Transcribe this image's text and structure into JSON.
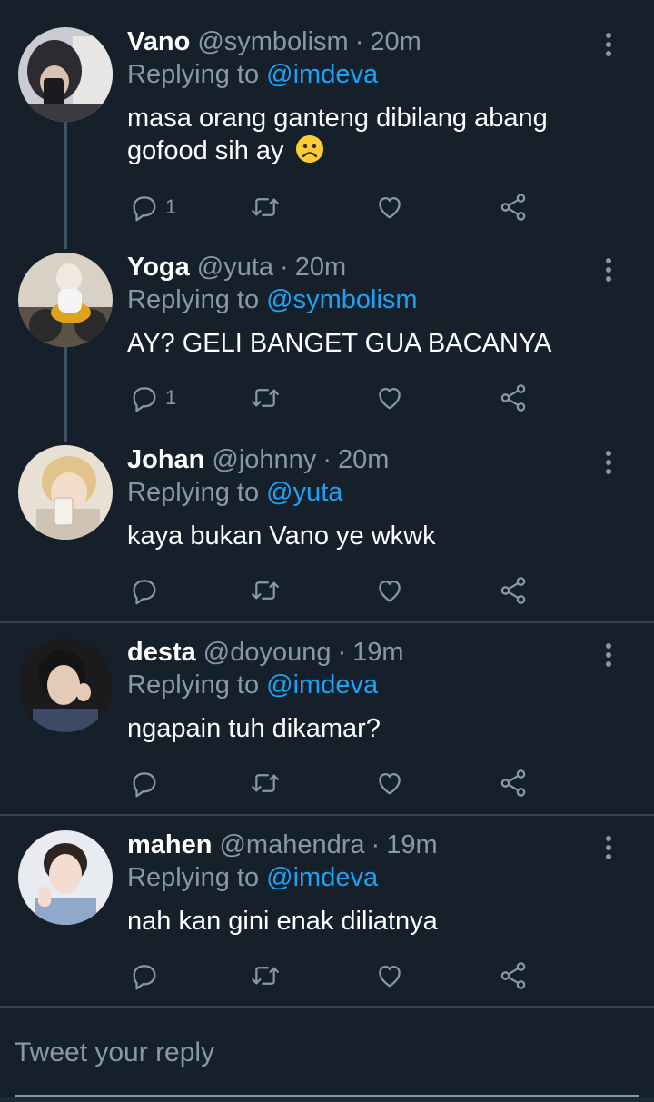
{
  "colors": {
    "background": "#15202b",
    "text": "#ffffff",
    "muted": "#8899a6",
    "link": "#1da1f2",
    "divider": "#38444d",
    "thread_line": "#3d5466"
  },
  "replying_prefix": "Replying to",
  "tweets": [
    {
      "name": "Vano",
      "handle": "@symbolism",
      "time": "20m",
      "replying_to": "@imdeva",
      "text": "masa orang ganteng dibilang abang gofood sih ay",
      "emoji": "frowning-face",
      "reply_count": "1",
      "avatar": "avatar-hooded-person-with-phone"
    },
    {
      "name": "Yoga",
      "handle": "@yuta",
      "time": "20m",
      "replying_to": "@symbolism",
      "text": "AY? GELI BANGET GUA BACANYA",
      "reply_count": "1",
      "avatar": "avatar-person-on-motorcycle"
    },
    {
      "name": "Johan",
      "handle": "@johnny",
      "time": "20m",
      "replying_to": "@yuta",
      "text": "kaya bukan Vano ye wkwk",
      "reply_count": "",
      "avatar": "avatar-mirror-selfie"
    },
    {
      "name": "desta",
      "handle": "@doyoung",
      "time": "19m",
      "replying_to": "@imdeva",
      "text": "ngapain tuh dikamar?",
      "reply_count": "",
      "avatar": "avatar-dark-portrait"
    },
    {
      "name": "mahen",
      "handle": "@mahendra",
      "time": "19m",
      "replying_to": "@imdeva",
      "text": "nah kan gini enak diliatnya",
      "reply_count": "",
      "avatar": "avatar-peace-sign"
    }
  ],
  "reply_box": {
    "placeholder": "Tweet your reply"
  },
  "icons": [
    "reply-icon",
    "retweet-icon",
    "like-icon",
    "share-icon",
    "more-options-icon"
  ]
}
